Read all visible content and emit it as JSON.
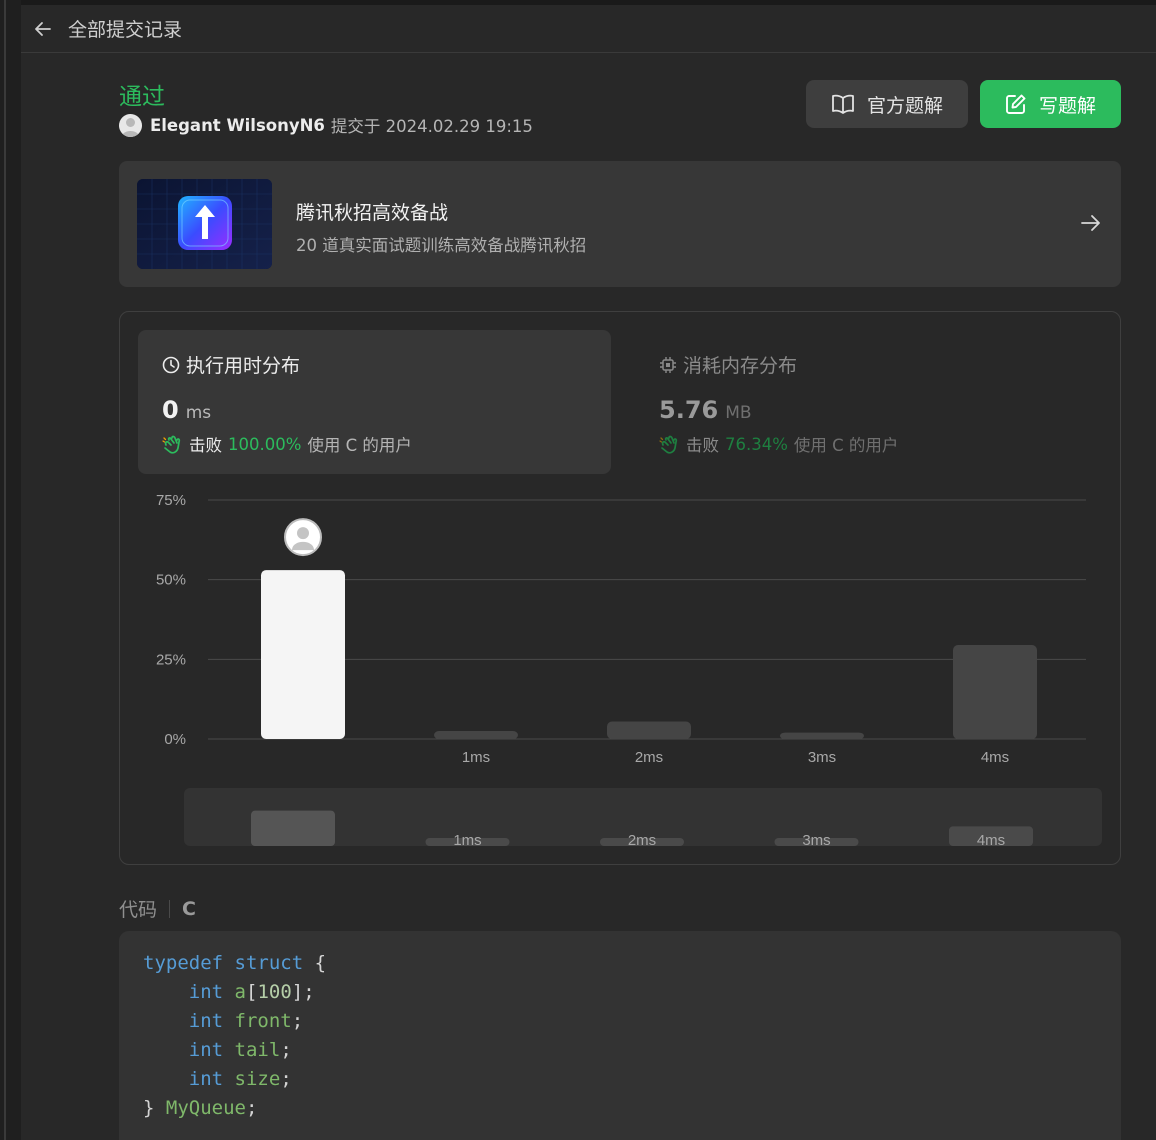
{
  "header": {
    "title": "全部提交记录"
  },
  "submission": {
    "status": "通过",
    "user": "Elegant WilsonyN6",
    "submitted_text": "提交于 2024.02.29 19:15"
  },
  "buttons": {
    "official": "官方题解",
    "write": "写题解"
  },
  "banner": {
    "title": "腾讯秋招高效备战",
    "subtitle": "20 道真实面试题训练高效备战腾讯秋招"
  },
  "runtime": {
    "title": "执行用时分布",
    "value": "0",
    "unit": "ms",
    "beats_word": "击败",
    "percent": "100.00%",
    "rest": "使用 C 的用户"
  },
  "memory": {
    "title": "消耗内存分布",
    "value": "5.76",
    "unit": "MB",
    "beats_word": "击败",
    "percent": "76.34%",
    "rest": "使用 C 的用户"
  },
  "chart_data": {
    "type": "bar",
    "categories": [
      "",
      "1ms",
      "2ms",
      "3ms",
      "4ms"
    ],
    "values": [
      53,
      2.5,
      5.5,
      2,
      29.5
    ],
    "highlight_index": 0,
    "y_ticks": [
      "0%",
      "25%",
      "50%",
      "75%"
    ],
    "ylim": [
      0,
      75
    ],
    "grid": true,
    "colors": {
      "highlight": "#f5f5f5",
      "bar": "#454545",
      "grid": "#4a4a4a"
    }
  },
  "code": {
    "label": "代码",
    "language": "C",
    "lines": [
      "typedef struct {",
      "    int a[100];",
      "    int front;",
      "    int tail;",
      "    int size;",
      "} MyQueue;"
    ]
  },
  "colors": {
    "accent": "#2cbb5d",
    "panel": "#282828",
    "card": "#373737"
  }
}
